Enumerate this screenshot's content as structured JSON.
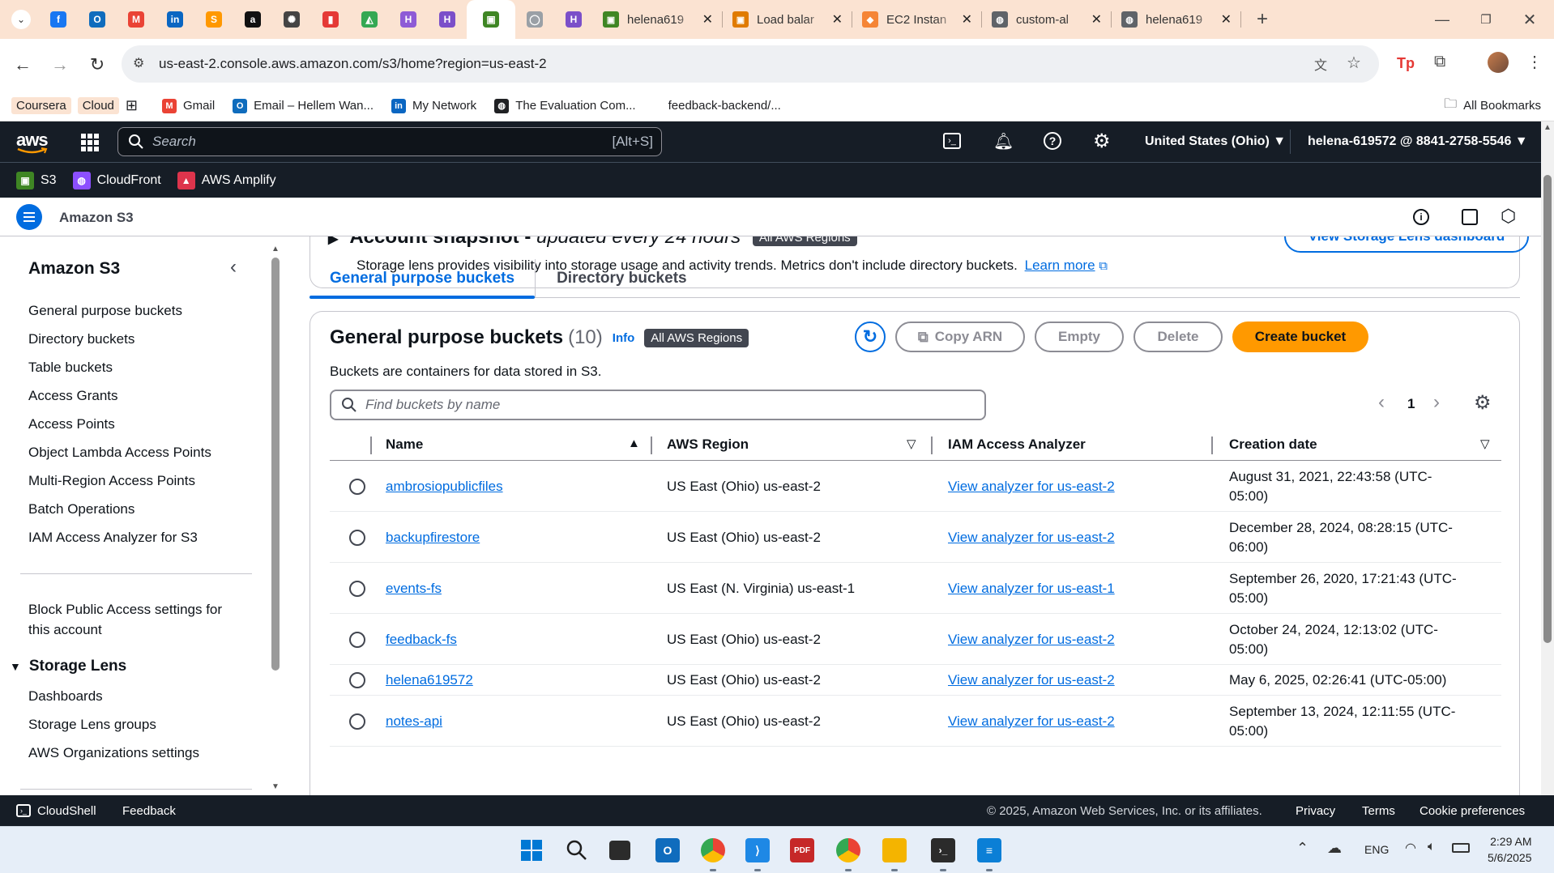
{
  "browser": {
    "pinned_tabs": [
      {
        "icon": "facebook-icon",
        "color": "#1877f2",
        "glyph": "f"
      },
      {
        "icon": "outlook-icon",
        "color": "#0f6cbd",
        "glyph": "O"
      },
      {
        "icon": "gmail-icon",
        "color": "#ea4335",
        "glyph": "M"
      },
      {
        "icon": "linkedin-icon",
        "color": "#0a66c2",
        "glyph": "in"
      },
      {
        "icon": "sublime-icon",
        "color": "#ff9800",
        "glyph": "S"
      },
      {
        "icon": "amazon-icon",
        "color": "#111111",
        "glyph": "a"
      },
      {
        "icon": "openai-icon",
        "color": "#444444",
        "glyph": "✺"
      },
      {
        "icon": "bar-icon",
        "color": "#e53935",
        "glyph": "▮"
      },
      {
        "icon": "drive-icon",
        "color": "#34a853",
        "glyph": "◭"
      },
      {
        "icon": "h-icon",
        "color": "#8e5bd6",
        "glyph": "H"
      },
      {
        "icon": "h-icon",
        "color": "#7b4fc9",
        "glyph": "H"
      },
      {
        "icon": "s3-icon",
        "color": "#3f8624",
        "glyph": "▣"
      },
      {
        "icon": "github-icon",
        "color": "#9aa0a6",
        "glyph": "◯"
      },
      {
        "icon": "h-icon",
        "color": "#7b4fc9",
        "glyph": "H"
      }
    ],
    "titled_tabs": [
      {
        "title": "helena619",
        "icon": "s3-icon",
        "color": "#3f8624",
        "glyph": "▣"
      },
      {
        "title": "Load balar",
        "icon": "ec2-icon",
        "color": "#e07b00",
        "glyph": "▣"
      },
      {
        "title": "EC2 Instan",
        "icon": "cube-icon",
        "color": "#f58536",
        "glyph": "◆"
      },
      {
        "title": "custom-al",
        "icon": "globe-icon",
        "color": "#5f6368",
        "glyph": "◍"
      },
      {
        "title": "helena619",
        "icon": "globe-icon",
        "color": "#5f6368",
        "glyph": "◍"
      }
    ],
    "url": "us-east-2.console.aws.amazon.com/s3/home?region=us-east-2",
    "bookmarks": [
      {
        "label": "Coursera",
        "icon": "",
        "color": ""
      },
      {
        "label": "Cloud",
        "icon": "",
        "color": ""
      },
      {
        "label": "",
        "icon": "apps-icon",
        "color": ""
      },
      {
        "label": "Gmail",
        "icon": "gmail-icon",
        "color": "#ea4335"
      },
      {
        "label": "Email – Hellem Wan...",
        "icon": "outlook-icon",
        "color": "#0f6cbd"
      },
      {
        "label": "My Network",
        "icon": "linkedin-icon",
        "color": "#0a66c2"
      },
      {
        "label": "The Evaluation Com...",
        "icon": "globe-icon",
        "color": "#202124"
      },
      {
        "label": "feedback-backend/...",
        "icon": "",
        "color": ""
      }
    ],
    "all_bookmarks": "All Bookmarks"
  },
  "aws": {
    "logo": "aws",
    "search_placeholder": "Search",
    "search_shortcut": "[Alt+S]",
    "region": "United States (Ohio) ▼",
    "account": "helena-619572 @ 8841-2758-5546 ▼",
    "favorites": [
      {
        "label": "S3",
        "color": "#3f8624",
        "glyph": "▣"
      },
      {
        "label": "CloudFront",
        "color": "#8c4fff",
        "glyph": "◍"
      },
      {
        "label": "AWS Amplify",
        "color": "#dd344c",
        "glyph": "▲"
      }
    ],
    "service_name": "Amazon S3"
  },
  "sidebar": {
    "title": "Amazon S3",
    "items": [
      "General purpose buckets",
      "Directory buckets",
      "Table buckets",
      "Access Grants",
      "Access Points",
      "Object Lambda Access Points",
      "Multi-Region Access Points",
      "Batch Operations",
      "IAM Access Analyzer for S3"
    ],
    "block_public_access": [
      "Block Public Access settings for",
      "this account"
    ],
    "storage_lens": {
      "title": "Storage Lens",
      "items": [
        "Dashboards",
        "Storage Lens groups",
        "AWS Organizations settings"
      ]
    }
  },
  "snapshot": {
    "title": "Account snapshot - ",
    "title_italic": "updated every 24 hours",
    "badge": "All AWS Regions",
    "description": "Storage lens provides visibility into storage usage and activity trends. Metrics don't include directory buckets.",
    "learn_more": "Learn more",
    "dashboard_button": "View Storage Lens dashboard"
  },
  "tabs": [
    {
      "label": "General purpose buckets",
      "active": true
    },
    {
      "label": "Directory buckets",
      "active": false
    }
  ],
  "buckets_panel": {
    "title": "General purpose buckets",
    "count": "(10)",
    "info": "Info",
    "badge": "All AWS Regions",
    "description": "Buckets are containers for data stored in S3.",
    "buttons": {
      "copy_arn": "Copy ARN",
      "empty": "Empty",
      "delete": "Delete",
      "create": "Create bucket"
    },
    "search_placeholder": "Find buckets by name",
    "page": "1",
    "columns": [
      "Name",
      "AWS Region",
      "IAM Access Analyzer",
      "Creation date"
    ],
    "rows": [
      {
        "name": "ambrosiopublicfiles",
        "region": "US East (Ohio) us-east-2",
        "analyzer": "View analyzer for us-east-2",
        "date1": "August 31, 2021, 22:43:58 (UTC-",
        "date2": "05:00)"
      },
      {
        "name": "backupfirestore",
        "region": "US East (Ohio) us-east-2",
        "analyzer": "View analyzer for us-east-2",
        "date1": "December 28, 2024, 08:28:15 (UTC-",
        "date2": "06:00)"
      },
      {
        "name": "events-fs",
        "region": "US East (N. Virginia) us-east-1",
        "analyzer": "View analyzer for us-east-1",
        "date1": "September 26, 2020, 17:21:43 (UTC-",
        "date2": "05:00)"
      },
      {
        "name": "feedback-fs",
        "region": "US East (Ohio) us-east-2",
        "analyzer": "View analyzer for us-east-2",
        "date1": "October 24, 2024, 12:13:02 (UTC-",
        "date2": "05:00)"
      },
      {
        "name": "helena619572",
        "region": "US East (Ohio) us-east-2",
        "analyzer": "View analyzer for us-east-2",
        "date1": "May 6, 2025, 02:26:41 (UTC-05:00)",
        "date2": ""
      },
      {
        "name": "notes-api",
        "region": "US East (Ohio) us-east-2",
        "analyzer": "View analyzer for us-east-2",
        "date1": "September 13, 2024, 12:11:55 (UTC-",
        "date2": "05:00)"
      }
    ]
  },
  "footer": {
    "cloudshell": "CloudShell",
    "feedback": "Feedback",
    "copyright": "© 2025, Amazon Web Services, Inc. or its affiliates.",
    "privacy": "Privacy",
    "terms": "Terms",
    "cookies": "Cookie preferences"
  },
  "taskbar": {
    "language": "ENG",
    "time": "2:29 AM",
    "date": "5/6/2025"
  },
  "colors": {
    "aws_nav": "#161d26",
    "link": "#006ce0",
    "accent_orange": "#ff9900",
    "tab_active": "#006ce0"
  }
}
